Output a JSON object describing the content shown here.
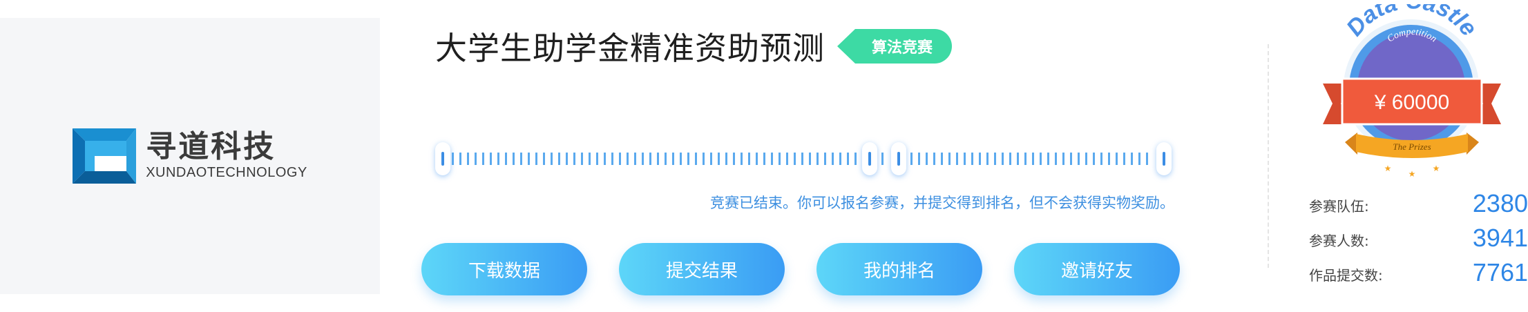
{
  "logo": {
    "name_cn": "寻道科技",
    "name_en": "XUNDAOTECHNOLOGY"
  },
  "competition": {
    "title": "大学生助学金精准资助预测",
    "tag": "算法竞赛",
    "notice": "竞赛已结束。你可以报名参赛，并提交得到排名，但不会获得实物奖励。"
  },
  "actions": [
    {
      "label": "下载数据"
    },
    {
      "label": "提交结果"
    },
    {
      "label": "我的排名"
    },
    {
      "label": "邀请好友"
    }
  ],
  "badge": {
    "brand": "Data Castle",
    "subtitle": "Competition",
    "prize": "¥ 60000",
    "ribbon": "The Prizes"
  },
  "stats": {
    "teams_label": "参赛队伍:",
    "teams_value": "2380",
    "participants_label": "参赛人数:",
    "participants_value": "3941",
    "submissions_label": "作品提交数:",
    "submissions_value": "7761"
  },
  "colors": {
    "accent_blue": "#3a9cf4",
    "button_gradient_start": "#5dd6f8",
    "tag_green": "#3ddaa4",
    "notice_blue": "#3d8fe0",
    "badge_red": "#f05a3c",
    "badge_purple": "#7067c8",
    "badge_ribbon": "#f5a623"
  }
}
